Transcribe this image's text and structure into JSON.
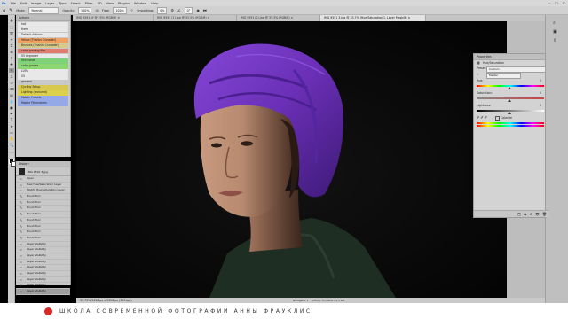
{
  "menubar": {
    "items": [
      "File",
      "Edit",
      "Image",
      "Layer",
      "Type",
      "Select",
      "Filter",
      "3D",
      "View",
      "Plugins",
      "Window",
      "Help"
    ],
    "window_controls": [
      "–",
      "☐",
      "✕"
    ]
  },
  "options": {
    "mode_label": "Mode:",
    "mode_value": "Normal",
    "opacity_label": "Opacity:",
    "opacity_value": "100%",
    "flow_label": "Flow:",
    "flow_value": "100%",
    "smoothing_label": "Smoothing:",
    "smoothing_value": "0%",
    "angle_value": "0°"
  },
  "tabs": [
    {
      "label": "IMG 9591.tif @ 25% (RGB/8) ×",
      "active": false
    },
    {
      "label": "IMG 9591 (1).jpg @ 33.3% (RGB/8) ×",
      "active": false
    },
    {
      "label": "IMG 9591 (2).jpg @ 33.3% (RGB/8) ×",
      "active": false
    },
    {
      "label": "IMG 9591 3.jpg @ 33.7% (Hue/Saturation 1, Layer Mask/8) ×",
      "active": true
    }
  ],
  "swatches": {
    "title": "Actions",
    "items": [
      {
        "label": "hat",
        "color": "#e8e8e8"
      },
      {
        "label": "Hem",
        "color": "#e8e8e8"
      },
      {
        "label": "Default Actions",
        "color": "#e8e8e8"
      },
      {
        "label": "Yellow (Thanks Crusader)",
        "color": "#f0a060"
      },
      {
        "label": "Brushes (Thanks Crusader)",
        "color": "#d7c98a"
      },
      {
        "label": "color grading film",
        "color": "#e07c70"
      },
      {
        "label": "S5 degrader",
        "color": "#e8e8e8"
      },
      {
        "label": "Skin tones",
        "color": "#7fd27a"
      },
      {
        "label": "color grades",
        "color": "#8ad66f"
      },
      {
        "label": "LUTs",
        "color": "#e8e8e8"
      },
      {
        "label": "S5",
        "color": "#e8e8e8"
      },
      {
        "label": "general",
        "color": "#c8c8c8"
      },
      {
        "label": "Cycling Setup",
        "color": "#d8c84e"
      },
      {
        "label": "Lighting (textured)",
        "color": "#ddd14c"
      },
      {
        "label": "Mobile Presets",
        "color": "#95a9e8"
      },
      {
        "label": "Mobile Filmmakers",
        "color": "#95a9e8"
      }
    ]
  },
  "history": {
    "title": "History",
    "snapshot": "IMG 9591 3.jpg",
    "items": [
      "Open",
      "New Hue/Saturation Layer",
      "Modify Hue/Saturation Layer",
      "Brush Tool",
      "Brush Tool",
      "Brush Tool",
      "Brush Tool",
      "Brush Tool",
      "Brush Tool",
      "Brush Tool",
      "Brush Tool",
      "Layer Visibility",
      "Layer Visibility",
      "Layer Visibility",
      "Layer Visibility",
      "Layer Visibility",
      "Layer Visibility",
      "Layer Visibility",
      "Layer Visibility",
      "Layer Visibility"
    ],
    "selected_index": 19
  },
  "properties": {
    "title": "Properties",
    "subtitle": "Hue/Saturation",
    "preset_label": "Preset:",
    "preset_value": "Custom",
    "channel_value": "Master",
    "hue_label": "Hue:",
    "hue_value": "0",
    "saturation_label": "Saturation:",
    "saturation_value": "0",
    "lightness_label": "Lightness:",
    "lightness_value": "0",
    "colorize_label": "Colorize"
  },
  "status": {
    "text": "33.73%   3456 px x 3456 px (300 ppi)",
    "right_tabs": [
      "Navigator 1",
      "Actions Timeline 24.3 MB"
    ]
  },
  "banner": {
    "text": "ШКОЛА СОВРЕМЕННОЙ ФОТОГРАФИИ АННЫ ФРАУКЛИС"
  },
  "colors": {
    "turban": "#6a2fb5",
    "sweater": "#1f2e22"
  }
}
